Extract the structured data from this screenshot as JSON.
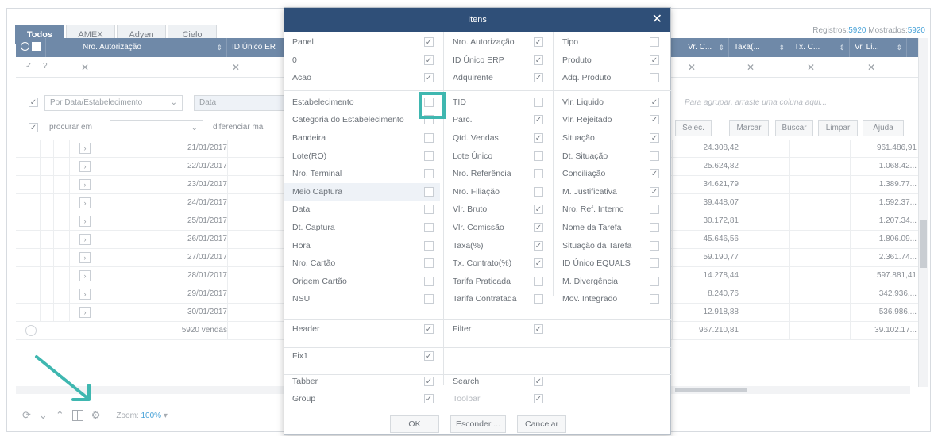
{
  "tabs": [
    "Todos",
    "AMEX",
    "Adyen",
    "Cielo"
  ],
  "counts": {
    "registros_label": "Registros:",
    "registros_value": "5920",
    "mostrados_label": "Mostrados:",
    "mostrados_value": "5920"
  },
  "grid_headers": {
    "nro_autorizacao": "Nro. Autorização",
    "id_unico_erp": "ID Único ER",
    "vr_c": "Vr. C...",
    "taxa": "Taxa(...",
    "tx_c": "Tx. C...",
    "vr_li": "Vr. Li..."
  },
  "toolbar": {
    "group_select": "Por Data/Estabelecimento",
    "date_input": "Data",
    "search_label": "procurar em",
    "diff_label": "diferenciar mai",
    "group_hint": "Para agrupar, arraste uma coluna aqui...",
    "btn_selec": "Selec.",
    "btn_marcar": "Marcar",
    "btn_buscar": "Buscar",
    "btn_limpar": "Limpar",
    "btn_ajuda": "Ajuda"
  },
  "rows": [
    {
      "date": "21/01/2017",
      "vr": "24.308,42",
      "vl": "961.486,91"
    },
    {
      "date": "22/01/2017",
      "vr": "25.624,82",
      "vl": "1.068.42..."
    },
    {
      "date": "23/01/2017",
      "vr": "34.621,79",
      "vl": "1.389.77..."
    },
    {
      "date": "24/01/2017",
      "vr": "39.448,07",
      "vl": "1.592.37..."
    },
    {
      "date": "25/01/2017",
      "vr": "30.172,81",
      "vl": "1.207.34..."
    },
    {
      "date": "26/01/2017",
      "vr": "45.646,56",
      "vl": "1.806.09..."
    },
    {
      "date": "27/01/2017",
      "vr": "59.190,77",
      "vl": "2.361.74..."
    },
    {
      "date": "28/01/2017",
      "vr": "14.278,44",
      "vl": "597.881,41"
    },
    {
      "date": "29/01/2017",
      "vr": "8.240,76",
      "vl": "342.936,..."
    },
    {
      "date": "30/01/2017",
      "vr": "12.918,88",
      "vl": "536.986,..."
    }
  ],
  "totals": {
    "label": "5920 vendas",
    "vr": "967.210,81",
    "vl": "39.102.17..."
  },
  "bottom": {
    "zoom_label": "Zoom:",
    "zoom_value": "100%"
  },
  "modal": {
    "title": "Itens",
    "col1": [
      {
        "label": "Panel",
        "checked": true
      },
      {
        "label": "0",
        "checked": true
      },
      {
        "label": "Acao",
        "checked": true
      },
      {
        "label": "Estabelecimento",
        "checked": false
      },
      {
        "label": "Categoria do Estabelecimento",
        "checked": false
      },
      {
        "label": "Bandeira",
        "checked": false
      },
      {
        "label": "Lote(RO)",
        "checked": false
      },
      {
        "label": "Nro. Terminal",
        "checked": false
      },
      {
        "label": "Meio Captura",
        "checked": false
      },
      {
        "label": "Data",
        "checked": false
      },
      {
        "label": "Dt. Captura",
        "checked": false
      },
      {
        "label": "Hora",
        "checked": false
      },
      {
        "label": "Nro. Cartão",
        "checked": false
      },
      {
        "label": "Origem Cartão",
        "checked": false
      },
      {
        "label": "NSU",
        "checked": false
      }
    ],
    "col2": [
      {
        "label": "Nro. Autorização",
        "checked": true
      },
      {
        "label": "ID Único ERP",
        "checked": true
      },
      {
        "label": "Adquirente",
        "checked": true
      },
      {
        "label": "TID",
        "checked": false
      },
      {
        "label": "Parc.",
        "checked": true
      },
      {
        "label": "Qtd. Vendas",
        "checked": true
      },
      {
        "label": "Lote Único",
        "checked": false
      },
      {
        "label": "Nro. Referência",
        "checked": false
      },
      {
        "label": "Nro. Filiação",
        "checked": false
      },
      {
        "label": "Vlr. Bruto",
        "checked": true
      },
      {
        "label": "Vlr. Comissão",
        "checked": true
      },
      {
        "label": "Taxa(%)",
        "checked": true
      },
      {
        "label": "Tx. Contrato(%)",
        "checked": true
      },
      {
        "label": "Tarifa Praticada",
        "checked": false
      },
      {
        "label": "Tarifa Contratada",
        "checked": false
      }
    ],
    "col3": [
      {
        "label": "Tipo",
        "checked": false
      },
      {
        "label": "Produto",
        "checked": true
      },
      {
        "label": "Adq. Produto",
        "checked": false
      },
      {
        "label": "Vlr. Liquido",
        "checked": true
      },
      {
        "label": "Vlr. Rejeitado",
        "checked": true
      },
      {
        "label": "Situação",
        "checked": true
      },
      {
        "label": "Dt. Situação",
        "checked": false
      },
      {
        "label": "Conciliação",
        "checked": true
      },
      {
        "label": "M. Justificativa",
        "checked": true
      },
      {
        "label": "Nro. Ref. Interno",
        "checked": false
      },
      {
        "label": "Nome da Tarefa",
        "checked": false
      },
      {
        "label": "Situação da Tarefa",
        "checked": false
      },
      {
        "label": "ID Único EQUALS",
        "checked": false
      },
      {
        "label": "M. Divergência",
        "checked": false
      },
      {
        "label": "Mov. Integrado",
        "checked": false
      }
    ],
    "section2": [
      {
        "label": "Header",
        "checked": true
      },
      {
        "label": "Filter",
        "checked": true
      }
    ],
    "section3": [
      {
        "label": "Fix1",
        "checked": true
      }
    ],
    "section4": [
      {
        "label": "Tabber",
        "checked": true
      },
      {
        "label": "Search",
        "checked": true
      },
      {
        "label": "Group",
        "checked": true
      },
      {
        "label": "Toolbar",
        "checked": true
      }
    ],
    "buttons": {
      "ok": "OK",
      "esconder": "Esconder ...",
      "cancelar": "Cancelar"
    }
  }
}
